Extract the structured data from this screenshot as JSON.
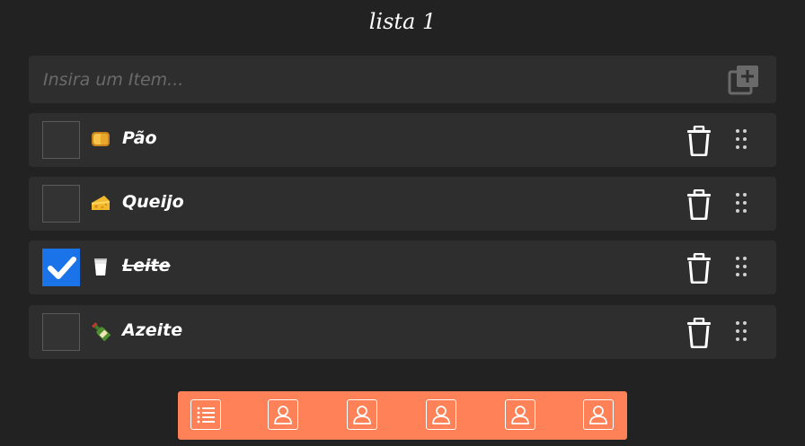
{
  "list_title": "lista 1",
  "add_item": {
    "placeholder": "Insira um Item..."
  },
  "items": [
    {
      "label": "Pão",
      "checked": false,
      "icon": "bread-icon"
    },
    {
      "label": "Queijo",
      "checked": false,
      "icon": "cheese-icon"
    },
    {
      "label": "Leite",
      "checked": true,
      "icon": "milk-icon"
    },
    {
      "label": "Azeite",
      "checked": false,
      "icon": "olive-oil-bottle-icon"
    }
  ],
  "bottom_nav": [
    {
      "icon": "list-icon"
    },
    {
      "icon": "user-icon"
    },
    {
      "icon": "user-icon"
    },
    {
      "icon": "user-icon"
    },
    {
      "icon": "user-icon"
    },
    {
      "icon": "user-icon"
    }
  ],
  "colors": {
    "background": "#222222",
    "row": "#2e2e2e",
    "checked": "#1a73e8",
    "nav_bar": "#ff8157"
  }
}
